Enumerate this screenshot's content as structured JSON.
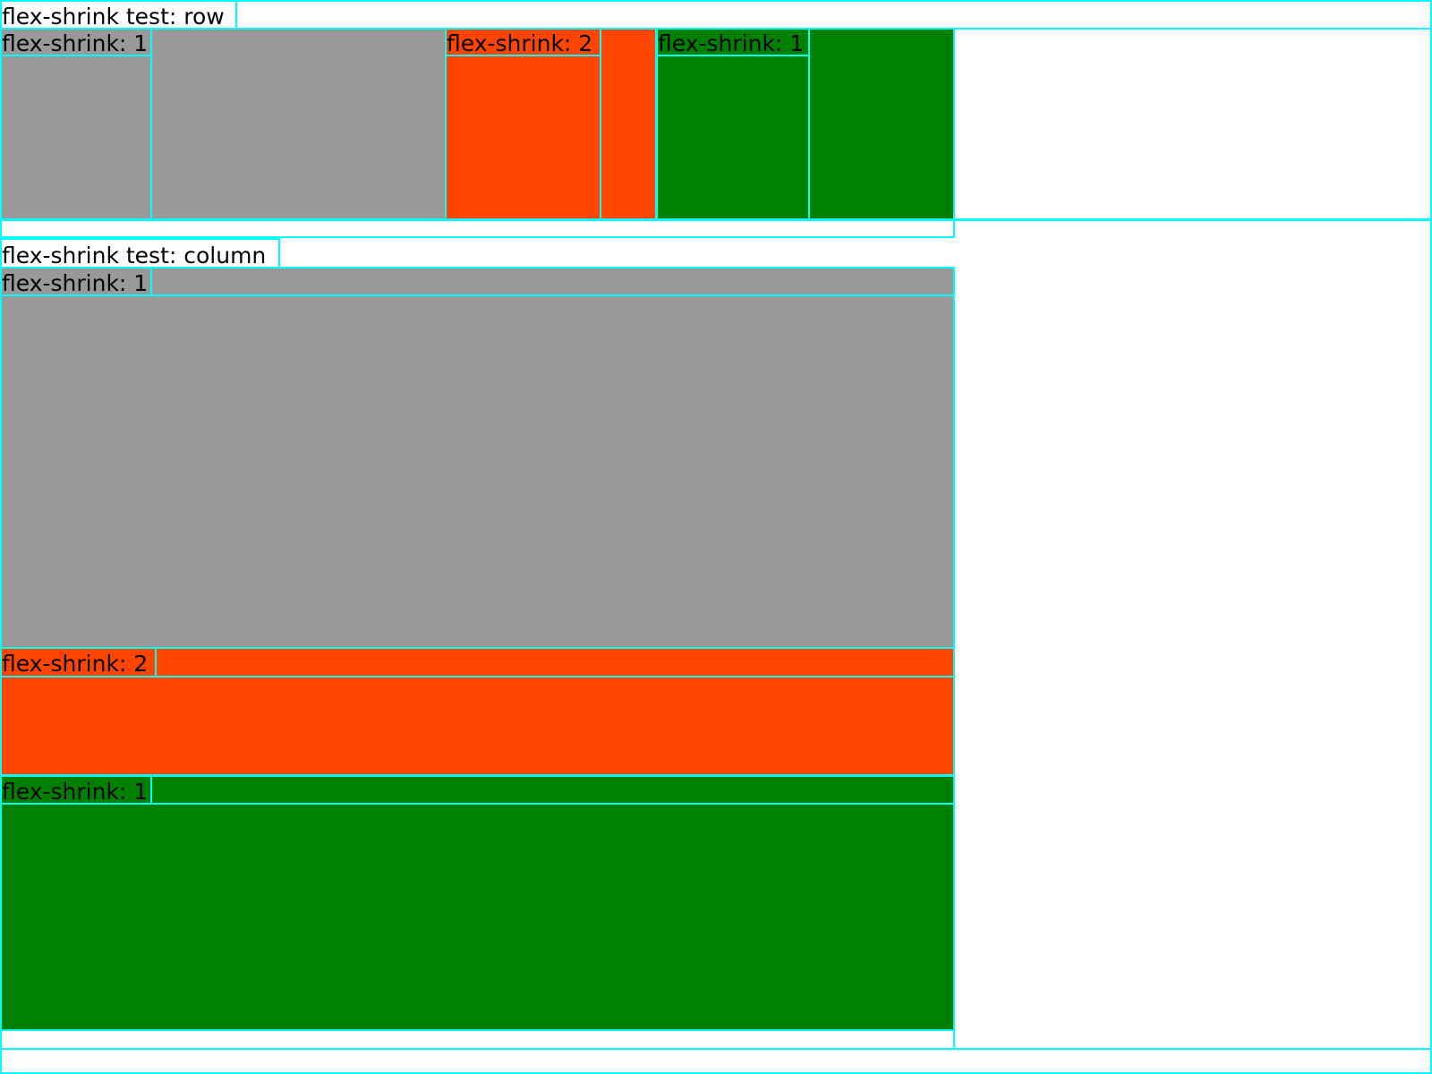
{
  "colors": {
    "outline": "#00ffff",
    "gray": "#999999",
    "red": "#ff4500",
    "green": "#008000",
    "background": "#ffffff"
  },
  "row_test": {
    "title": "flex-shrink test: row",
    "items": [
      {
        "label": "flex-shrink: 1",
        "color": "gray"
      },
      {
        "label": "flex-shrink: 2",
        "color": "red"
      },
      {
        "label": "flex-shrink: 1",
        "color": "green"
      }
    ]
  },
  "column_test": {
    "title": "flex-shrink test: column",
    "items": [
      {
        "label": "flex-shrink: 1",
        "color": "gray"
      },
      {
        "label": "flex-shrink: 2",
        "color": "red"
      },
      {
        "label": "flex-shrink: 1",
        "color": "green"
      }
    ]
  }
}
